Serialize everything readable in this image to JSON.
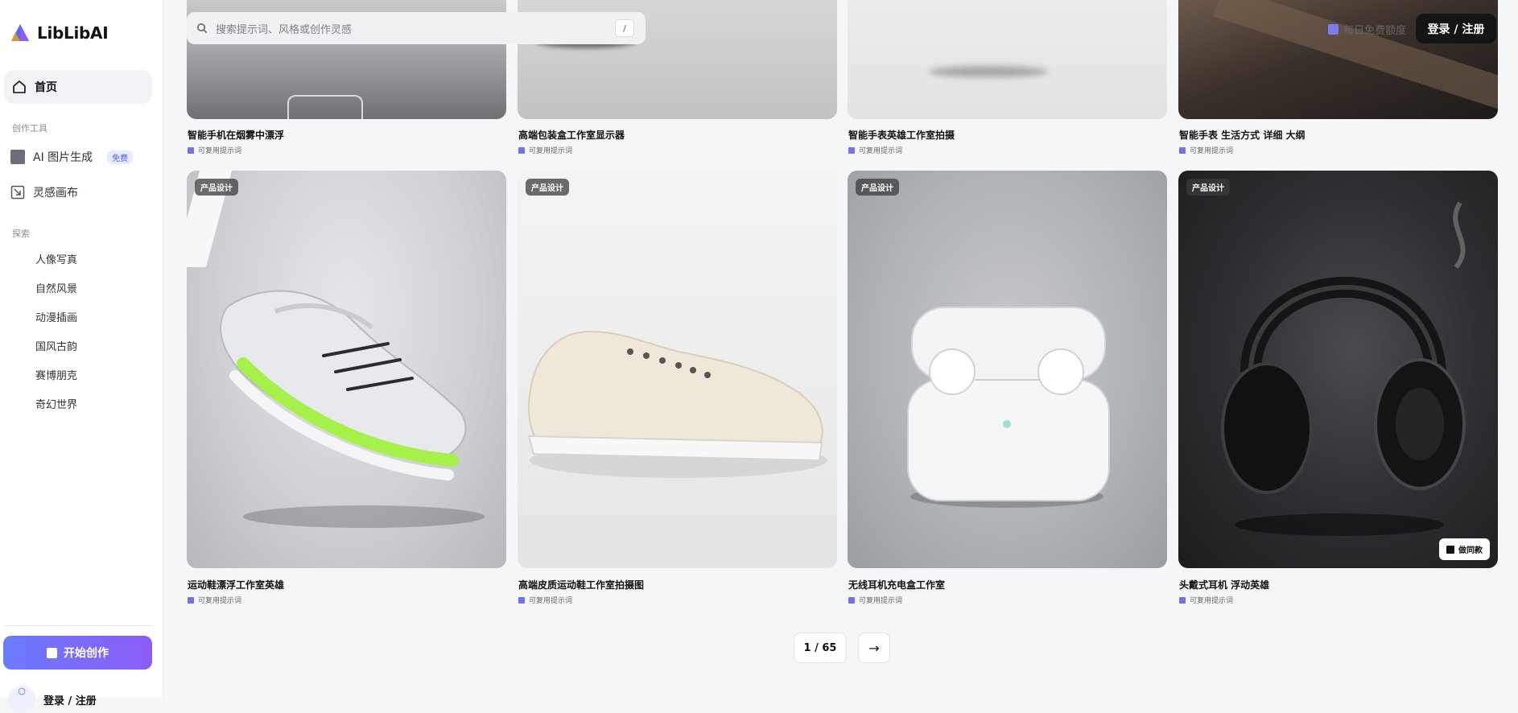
{
  "app": {
    "name": "LibLibAI"
  },
  "sidebar": {
    "home_label": "首页",
    "section_tools": "创作工具",
    "tools": [
      {
        "label": "AI 图片生成",
        "badge": "免费",
        "icon": "image-square-icon"
      },
      {
        "label": "灵感画布",
        "icon": "canvas-icon"
      }
    ],
    "section_explore": "探索",
    "explore": [
      "人像写真",
      "自然风景",
      "动漫插画",
      "国风古韵",
      "赛博朋克",
      "奇幻世界"
    ],
    "start_button": "开始创作",
    "login_label": "登录 / 注册"
  },
  "header": {
    "search_placeholder": "搜索提示词、风格或创作灵感",
    "shortcut": "/",
    "quota_label": "每日免费额度",
    "login_button": "登录 / 注册"
  },
  "cards_top": [
    {
      "title": "智能手机在烟雾中漂浮",
      "meta": "可复用提示词"
    },
    {
      "title": "高端包装盒工作室显示器",
      "meta": "可复用提示词"
    },
    {
      "title": "智能手表英雄工作室拍摄",
      "meta": "可复用提示词"
    },
    {
      "title": "智能手表 生活方式 详细 大纲",
      "meta": "可复用提示词"
    }
  ],
  "cards": [
    {
      "tag": "产品设计",
      "title": "运动鞋漂浮工作室英雄",
      "meta": "可复用提示词"
    },
    {
      "tag": "产品设计",
      "title": "高端皮质运动鞋工作室拍摄图",
      "meta": "可复用提示词"
    },
    {
      "tag": "产品设计",
      "title": "无线耳机充电盒工作室",
      "meta": "可复用提示词"
    },
    {
      "tag": "产品设计",
      "title": "头戴式耳机 浮动英雄",
      "meta": "可复用提示词",
      "action": "做同款"
    }
  ],
  "pagination": {
    "indicator": "1 / 65",
    "next": "→"
  },
  "colors": {
    "accent": "#6a7bff",
    "accent2": "#8b5cf6",
    "dark": "#141416"
  }
}
